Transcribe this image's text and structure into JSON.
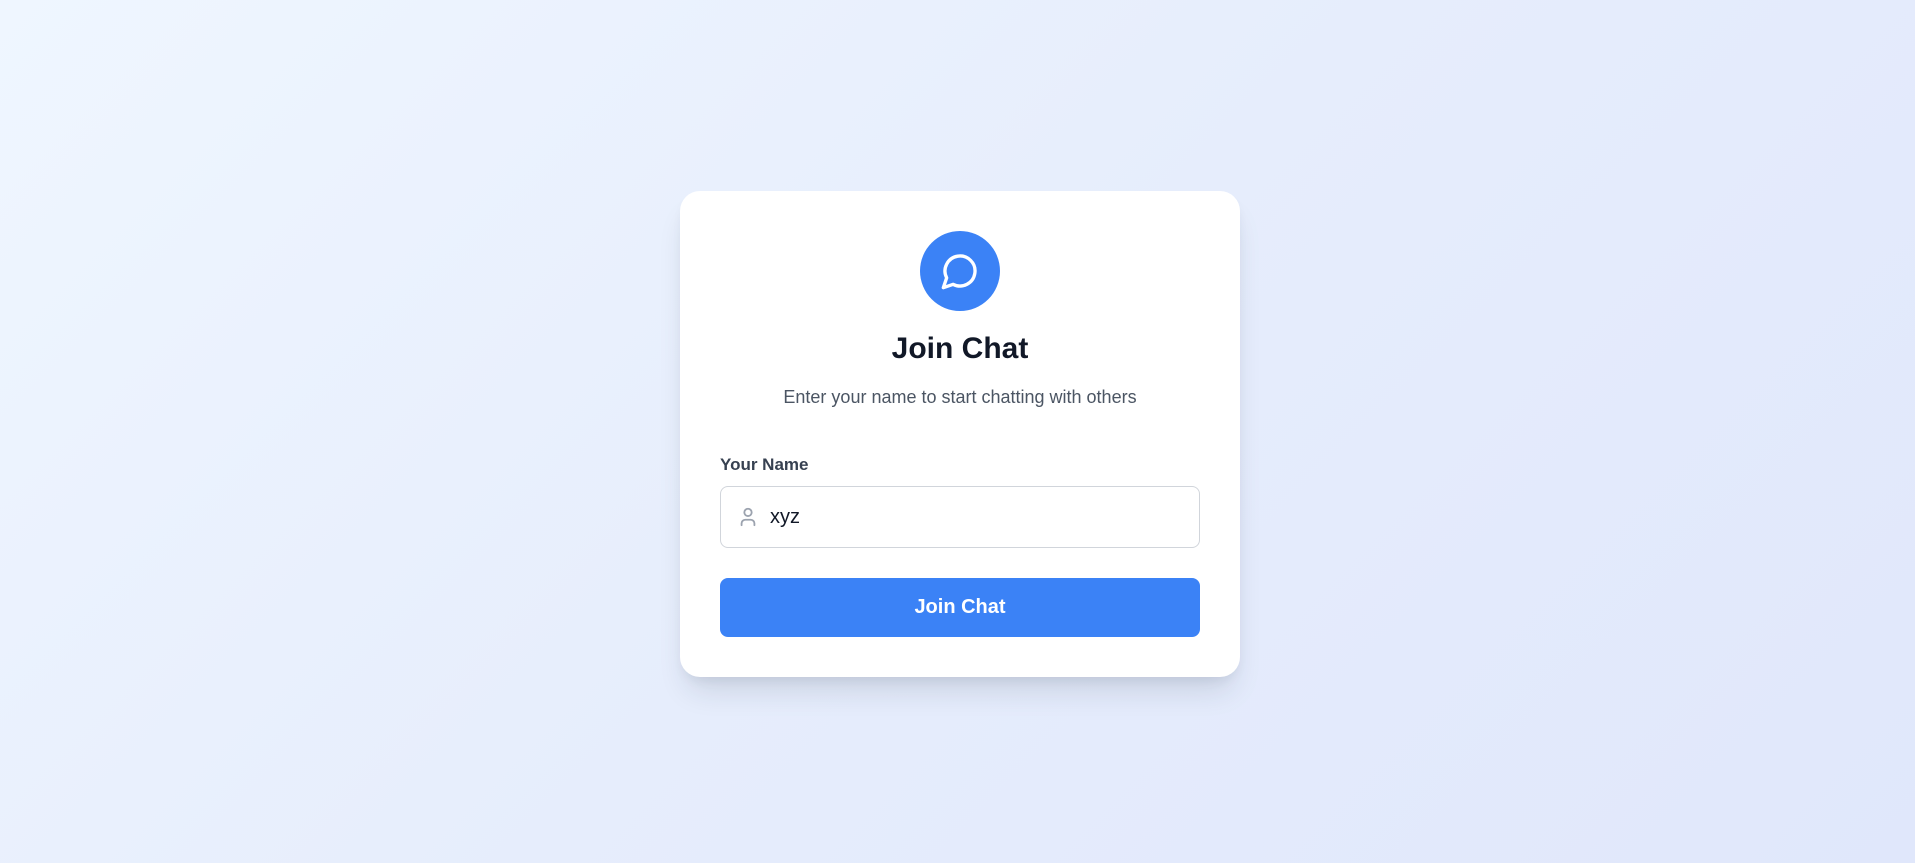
{
  "card": {
    "logo_icon": "message-circle-icon",
    "title": "Join Chat",
    "subtitle": "Enter your name to start chatting with others"
  },
  "form": {
    "name_label": "Your Name",
    "name_icon": "user-icon",
    "name_value": "xyz",
    "submit_label": "Join Chat"
  },
  "colors": {
    "accent": "#3b82f6",
    "title": "#111827",
    "subtitle": "#4b5563",
    "background": "#e8eefd"
  }
}
